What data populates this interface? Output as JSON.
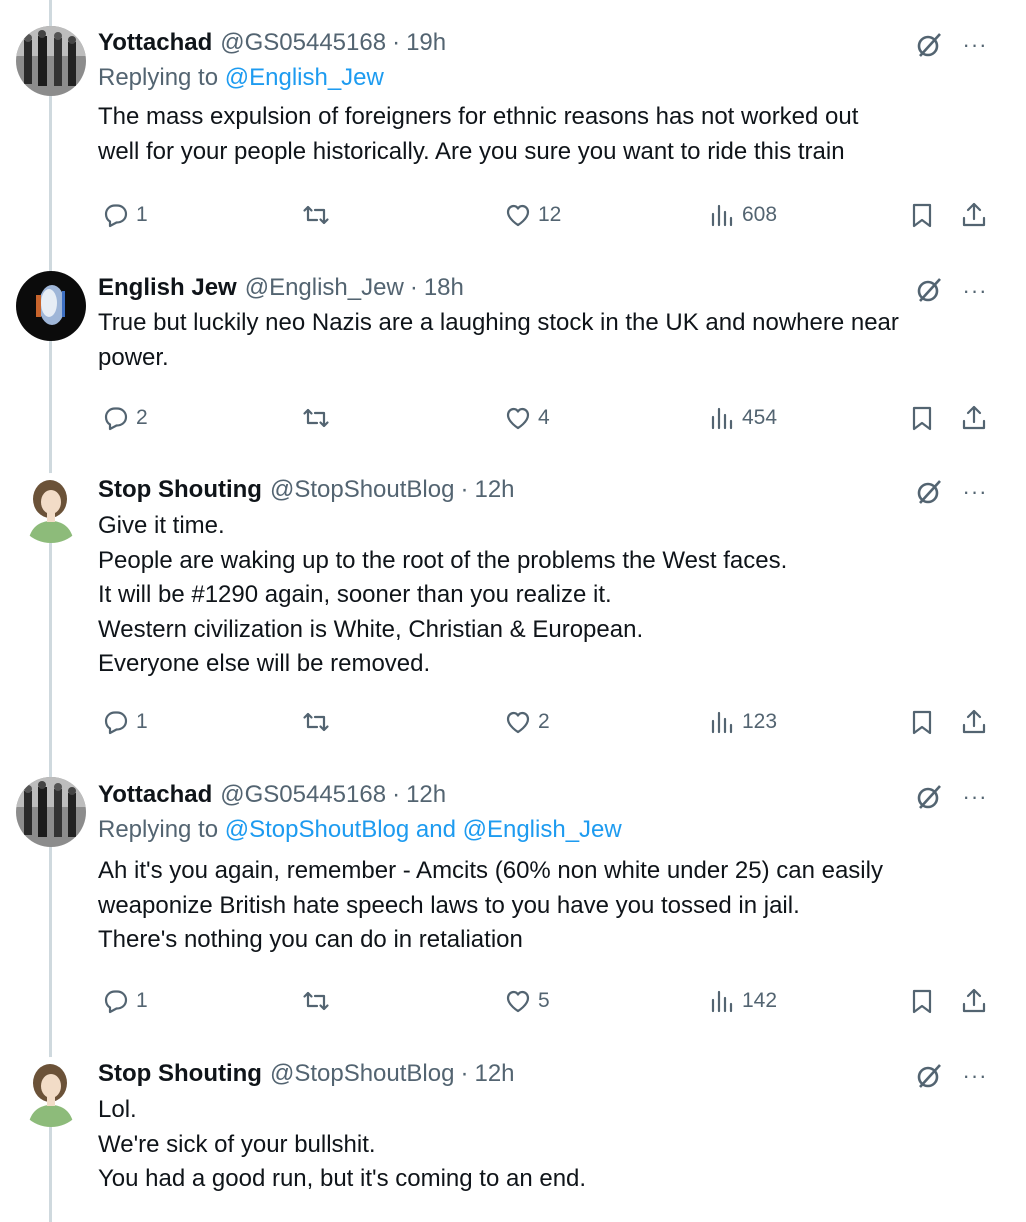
{
  "tweets": [
    {
      "name": "Yottachad",
      "handle": "@GS05445168",
      "sep": "·",
      "time": "19h",
      "reply_prefix": "Replying to ",
      "reply_mentions": "@English_Jew",
      "lines": [
        "The mass expulsion of foreigners for ethnic reasons has not worked out",
        "well for your people historically.   Are you sure you want to ride this train"
      ],
      "replies": "1",
      "retweets": "",
      "likes": "12",
      "views": "608"
    },
    {
      "name": "English Jew",
      "handle": "@English_Jew",
      "sep": "·",
      "time": "18h",
      "lines": [
        "True but luckily neo Nazis are a laughing stock in the UK and nowhere near",
        "power."
      ],
      "replies": "2",
      "retweets": "",
      "likes": "4",
      "views": "454"
    },
    {
      "name": "Stop Shouting",
      "handle": "@StopShoutBlog",
      "sep": "·",
      "time": "12h",
      "lines": [
        "Give it time.",
        "People are waking up to the root of the problems the West faces.",
        "It will be #1290 again, sooner than you realize it.",
        "Western civilization is White, Christian & European.",
        "Everyone else will be removed."
      ],
      "replies": "1",
      "retweets": "",
      "likes": "2",
      "views": "123"
    },
    {
      "name": "Yottachad",
      "handle": "@GS05445168",
      "sep": "·",
      "time": "12h",
      "reply_prefix": "Replying to ",
      "reply_mentions": "@StopShoutBlog and @English_Jew",
      "lines": [
        "Ah it's you again, remember - Amcits (60% non white under 25) can easily",
        "weaponize British hate speech laws to you have you tossed in jail.",
        "There's nothing you can do in retaliation"
      ],
      "replies": "1",
      "retweets": "",
      "likes": "5",
      "views": "142"
    },
    {
      "name": "Stop Shouting",
      "handle": "@StopShoutBlog",
      "sep": "·",
      "time": "12h",
      "lines": [
        "Lol.",
        "We're sick of your bullshit.",
        "You had a good run, but it's coming to an end."
      ]
    }
  ],
  "icons": {
    "more": "···",
    "grok": "grok-icon",
    "reply": "reply-icon",
    "retweet": "retweet-icon",
    "like": "heart-icon",
    "views": "views-icon",
    "bookmark": "bookmark-icon",
    "share": "share-icon"
  },
  "colors": {
    "text": "#0f1419",
    "secondary": "#536471",
    "link": "#1d9bf0",
    "thread_line": "#cfd9de"
  }
}
